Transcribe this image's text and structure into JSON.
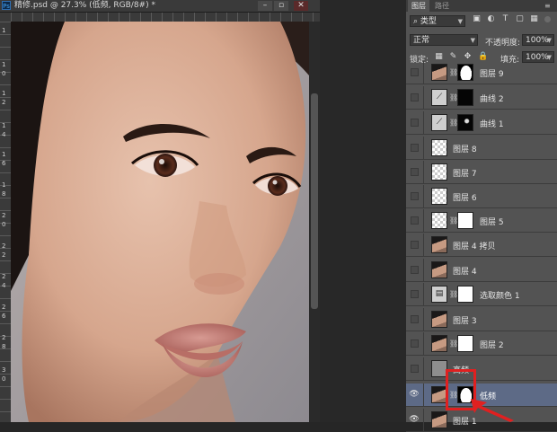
{
  "document": {
    "title": "精修.psd @ 27.3% (低频, RGB/8#) *",
    "ps_badge": "Ps",
    "controls": [
      "–",
      "▫",
      "✕"
    ],
    "left_ruler_numbers": [
      "1",
      "1",
      "0",
      "1",
      "2",
      "1",
      "4",
      "1",
      "6",
      "1",
      "8",
      "2",
      "0",
      "2",
      "2",
      "2",
      "4",
      "2",
      "6",
      "2",
      "8",
      "3",
      "0"
    ]
  },
  "layers_panel": {
    "tabs": [
      "图层",
      "路径"
    ],
    "filter_label": "类型",
    "filter_icons": [
      "image-icon",
      "adjust-icon",
      "text-icon",
      "shape-icon",
      "smart-icon"
    ],
    "filter_glyphs": [
      "▣",
      "◐",
      "T",
      "▢",
      "▦"
    ],
    "blend_mode": "正常",
    "opacity_label": "不透明度:",
    "opacity_value": "100%",
    "lock_label": "锁定:",
    "fill_label": "填充:",
    "fill_value": "100%",
    "lock_glyphs": [
      "▦",
      "✎",
      "✥",
      "🔒"
    ],
    "layers": [
      {
        "name": "图层 9",
        "visible": false,
        "thumb": "face",
        "mask": "shape",
        "selected": false
      },
      {
        "name": "曲线 2",
        "visible": false,
        "thumb": "adj",
        "mask": "black",
        "selected": false
      },
      {
        "name": "曲线 1",
        "visible": false,
        "thumb": "adj",
        "mask": "spot",
        "selected": false
      },
      {
        "name": "图层 8",
        "visible": false,
        "thumb": "trans",
        "mask": null,
        "selected": false
      },
      {
        "name": "图层 7",
        "visible": false,
        "thumb": "trans",
        "mask": null,
        "selected": false
      },
      {
        "name": "图层 6",
        "visible": false,
        "thumb": "trans",
        "mask": null,
        "selected": false
      },
      {
        "name": "图层 5",
        "visible": false,
        "thumb": "trans",
        "mask": "white",
        "selected": false
      },
      {
        "name": "图层 4 拷贝",
        "visible": false,
        "thumb": "face",
        "mask": null,
        "selected": false
      },
      {
        "name": "图层 4",
        "visible": false,
        "thumb": "face",
        "mask": null,
        "selected": false
      },
      {
        "name": "选取颜色 1",
        "visible": false,
        "thumb": "adj",
        "mask": "white",
        "selected": false
      },
      {
        "name": "图层 3",
        "visible": false,
        "thumb": "face",
        "mask": null,
        "selected": false
      },
      {
        "name": "图层 2",
        "visible": false,
        "thumb": "face",
        "mask": "white",
        "selected": false
      },
      {
        "name": "高频",
        "visible": false,
        "thumb": "gray",
        "mask": null,
        "selected": false
      },
      {
        "name": "低频",
        "visible": true,
        "thumb": "face",
        "mask": "shape",
        "selected": true
      },
      {
        "name": "图层 1",
        "visible": true,
        "thumb": "face",
        "mask": null,
        "selected": false
      }
    ]
  },
  "colors": {
    "panel_bg": "#535353",
    "selected_row": "#5d6a86",
    "highlight_red": "#e02020"
  }
}
